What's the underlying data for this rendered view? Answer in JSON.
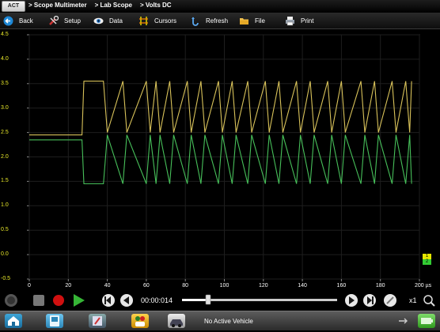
{
  "breadcrumb": [
    "> Scope Multimeter",
    "> Lab Scope",
    "> Volts DC"
  ],
  "logo_text": "ACT",
  "toolbar": {
    "back": "Back",
    "setup": "Setup",
    "data": "Data",
    "cursors": "Cursors",
    "refresh": "Refresh",
    "file": "File",
    "print": "Print"
  },
  "y_ticks": [
    "4.5",
    "4.0",
    "3.5",
    "3.0",
    "2.5",
    "2.0",
    "1.5",
    "1.0",
    "0.5",
    "0.0",
    "-0.5"
  ],
  "x_ticks": [
    "0",
    "20",
    "40",
    "60",
    "80",
    "100",
    "120",
    "140",
    "160",
    "180",
    "200 µs"
  ],
  "trace_markers": [
    "1",
    "2"
  ],
  "playback": {
    "time": "00:00:014",
    "zoom": "x1"
  },
  "taskbar": {
    "status": "No Active Vehicle"
  },
  "colors": {
    "trace1": "#d8c25a",
    "trace2": "#47c05a",
    "y_axis_labels": "#e8e82a",
    "marker1": "#e6e600",
    "marker2": "#33cc33"
  },
  "chart_data": {
    "type": "line",
    "xlabel": "",
    "ylabel": "",
    "xlim": [
      0,
      200
    ],
    "ylim": [
      -0.5,
      4.5
    ],
    "series": [
      {
        "x": [
          0,
          27,
          28,
          38,
          40,
          48,
          50,
          60,
          62,
          65,
          67,
          72,
          74,
          81,
          83,
          88,
          90,
          97,
          99,
          104,
          106,
          112,
          114,
          121,
          123,
          128,
          130,
          137,
          139,
          144,
          146,
          153,
          155,
          160,
          162,
          170,
          172,
          177,
          179,
          186,
          188,
          193,
          195,
          196
        ],
        "y": [
          2.45,
          2.45,
          3.55,
          3.55,
          2.5,
          3.55,
          2.5,
          3.55,
          2.5,
          3.55,
          2.5,
          3.55,
          2.5,
          3.55,
          2.5,
          3.55,
          2.5,
          3.55,
          2.5,
          3.55,
          2.5,
          3.55,
          2.5,
          3.55,
          2.5,
          3.55,
          2.5,
          3.55,
          2.5,
          3.55,
          2.5,
          3.55,
          2.5,
          3.55,
          2.5,
          3.55,
          2.5,
          3.55,
          2.5,
          3.55,
          2.5,
          3.55,
          2.5,
          3.55
        ]
      },
      {
        "x": [
          0,
          27,
          28,
          38,
          40,
          48,
          50,
          60,
          62,
          65,
          67,
          72,
          74,
          81,
          83,
          88,
          90,
          97,
          99,
          104,
          106,
          112,
          114,
          121,
          123,
          128,
          130,
          137,
          139,
          144,
          146,
          153,
          155,
          160,
          162,
          170,
          172,
          177,
          179,
          186,
          188,
          193,
          195,
          196
        ],
        "y": [
          2.35,
          2.35,
          1.45,
          1.45,
          2.45,
          1.45,
          2.45,
          1.45,
          2.45,
          1.45,
          2.45,
          1.45,
          2.45,
          1.45,
          2.45,
          1.45,
          2.45,
          1.45,
          2.45,
          1.45,
          2.45,
          1.45,
          2.45,
          1.45,
          2.45,
          1.45,
          2.45,
          1.45,
          2.45,
          1.45,
          2.45,
          1.45,
          2.45,
          1.45,
          2.45,
          1.45,
          2.45,
          1.45,
          2.45,
          1.45,
          2.45,
          1.45,
          2.45,
          1.45
        ]
      }
    ]
  }
}
